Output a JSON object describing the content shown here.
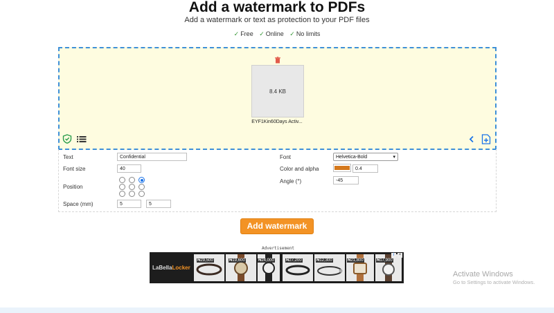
{
  "header": {
    "title": "Add a watermark to PDFs",
    "subtitle": "Add a watermark or text as protection to your PDF files",
    "features": [
      "Free",
      "Online",
      "No limits"
    ]
  },
  "file": {
    "size": "8.4 KB",
    "name": "EYF1Kin60Days Activ..."
  },
  "options": {
    "text_label": "Text",
    "text_value": "Confidential",
    "font_size_label": "Font size",
    "font_size_value": "40",
    "position_label": "Position",
    "position_selected": "top-right",
    "space_label": "Space (mm)",
    "space_x": "5",
    "space_y": "5",
    "font_label": "Font",
    "font_value": "Helvetica-Bold",
    "color_label": "Color and alpha",
    "color_value": "#d4781c",
    "alpha_value": "0.4",
    "angle_label": "Angle (°)",
    "angle_value": "-45"
  },
  "action": {
    "submit_label": "Add watermark"
  },
  "ad": {
    "label": "Advertisement",
    "brand_prefix": "LaBella",
    "brand_accent": "Locker",
    "prices": [
      "₦29,500",
      "₦19,600",
      "₦24,000",
      "₦27,200",
      "₦12,300",
      "₦21,800",
      "₦17,900"
    ]
  },
  "windows_notice": {
    "line1": "Activate Windows",
    "line2": "Go to Settings to activate Windows."
  },
  "colors": {
    "accent": "#f39325",
    "dropzone_bg": "#fefce0",
    "dropzone_border": "#3d8fd8",
    "check_green": "#3a9a3a"
  }
}
